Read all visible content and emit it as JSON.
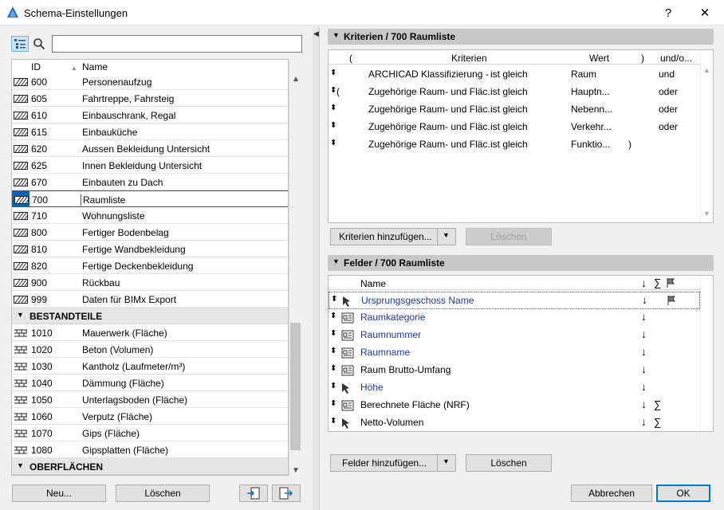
{
  "window": {
    "title": "Schema-Einstellungen",
    "help": "?",
    "close": "✕"
  },
  "left": {
    "search_value": "",
    "columns": {
      "id": "ID",
      "name": "Name"
    },
    "rows": [
      {
        "id": "600",
        "name": "Personenaufzug"
      },
      {
        "id": "605",
        "name": "Fahrtreppe, Fahrsteig"
      },
      {
        "id": "610",
        "name": "Einbauschrank, Regal"
      },
      {
        "id": "615",
        "name": "Einbauküche"
      },
      {
        "id": "620",
        "name": "Aussen Bekleidung Untersicht"
      },
      {
        "id": "625",
        "name": "Innen Bekleidung Untersicht"
      },
      {
        "id": "670",
        "name": "Einbauten zu Dach"
      },
      {
        "id": "700",
        "name": "Raumliste"
      },
      {
        "id": "710",
        "name": "Wohnungsliste"
      },
      {
        "id": "800",
        "name": "Fertiger Bodenbelag"
      },
      {
        "id": "810",
        "name": "Fertige Wandbekleidung"
      },
      {
        "id": "820",
        "name": "Fertige Deckenbekleidung"
      },
      {
        "id": "900",
        "name": "Rückbau"
      },
      {
        "id": "999",
        "name": "Daten für BIMx Export"
      }
    ],
    "group1": "BESTANDTEILE",
    "rows2": [
      {
        "id": "1010",
        "name": "Mauerwerk (Fläche)"
      },
      {
        "id": "1020",
        "name": "Beton (Volumen)"
      },
      {
        "id": "1030",
        "name": "Kantholz (Laufmeter/m³)"
      },
      {
        "id": "1040",
        "name": "Dämmung (Fläche)"
      },
      {
        "id": "1050",
        "name": "Unterlagsboden (Fläche)"
      },
      {
        "id": "1060",
        "name": "Verputz (Fläche)"
      },
      {
        "id": "1070",
        "name": "Gips (Fläche)"
      },
      {
        "id": "1080",
        "name": "Gipsplatten (Fläche)"
      }
    ],
    "group2": "OBERFLÄCHEN",
    "new_button": "Neu...",
    "delete_button": "Löschen"
  },
  "criteria": {
    "header": "Kriterien / 700 Raumliste",
    "columns": {
      "paren_open": "(",
      "criteria": "Kriterien",
      "value": "Wert",
      "paren_close": ")",
      "andor": "und/o..."
    },
    "rows": [
      {
        "open": "",
        "criteria": "ARCHICAD Klassifizierung - ...",
        "op": "ist gleich",
        "value": "Raum",
        "close": "",
        "andor": "und"
      },
      {
        "open": "(",
        "criteria": "Zugehörige Raum- und Fläc...",
        "op": "ist gleich",
        "value": "Hauptn...",
        "close": "",
        "andor": "oder"
      },
      {
        "open": "",
        "criteria": "Zugehörige Raum- und Fläc...",
        "op": "ist gleich",
        "value": "Nebenn...",
        "close": "",
        "andor": "oder"
      },
      {
        "open": "",
        "criteria": "Zugehörige Raum- und Fläc...",
        "op": "ist gleich",
        "value": "Verkehr...",
        "close": "",
        "andor": "oder"
      },
      {
        "open": "",
        "criteria": "Zugehörige Raum- und Fläc...",
        "op": "ist gleich",
        "value": "Funktio...",
        "close": ")",
        "andor": ""
      }
    ],
    "add_button": "Kriterien hinzufügen...",
    "delete_button": "Löschen"
  },
  "fields": {
    "header": "Felder / 700 Raumliste",
    "col_name": "Name",
    "rows": [
      {
        "name": "Ursprungsgeschoss Name",
        "blue": true,
        "sum": "",
        "flag": true
      },
      {
        "name": "Raumkategorie",
        "blue": true,
        "sum": "",
        "flag": false
      },
      {
        "name": "Raumnummer",
        "blue": true,
        "sum": "",
        "flag": false
      },
      {
        "name": "Raumname",
        "blue": true,
        "sum": "",
        "flag": false
      },
      {
        "name": "Raum Brutto-Umfang",
        "blue": false,
        "sum": "",
        "flag": false
      },
      {
        "name": "Höhe",
        "blue": true,
        "sum": "",
        "flag": false
      },
      {
        "name": "Berechnete Fläche (NRF)",
        "blue": false,
        "sum": "∑",
        "flag": false
      },
      {
        "name": "Netto-Volumen",
        "blue": false,
        "sum": "∑",
        "flag": false
      }
    ],
    "add_button": "Felder hinzufügen...",
    "delete_button": "Löschen"
  },
  "footer": {
    "cancel": "Abbrechen",
    "ok": "OK"
  }
}
